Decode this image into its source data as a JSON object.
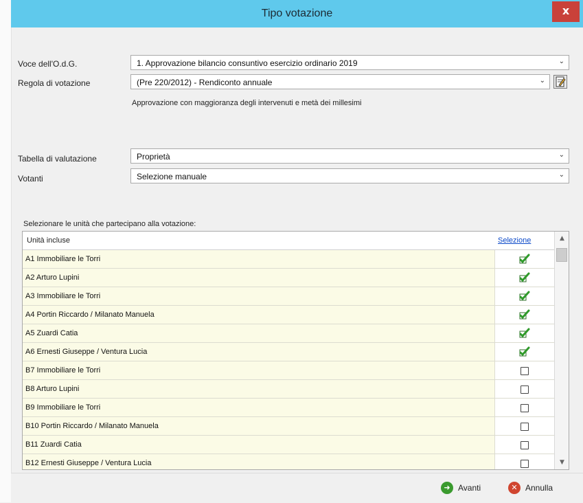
{
  "window": {
    "title": "Tipo votazione",
    "close_glyph": "x"
  },
  "form": {
    "voce_label": "Voce dell'O.d.G.",
    "voce_value": "1. Approvazione bilancio consuntivo esercizio ordinario 2019",
    "regola_label": "Regola di votazione",
    "regola_value": "(Pre 220/2012) - Rendiconto annuale",
    "regola_note": "Approvazione con maggioranza degli intervenuti e metà dei millesimi",
    "tabella_label": "Tabella di valutazione",
    "tabella_value": "Proprietà",
    "votanti_label": "Votanti",
    "votanti_value": "Selezione manuale"
  },
  "units": {
    "prompt": "Selezionare le unità che partecipano alla votazione:",
    "col_units": "Unità incluse",
    "col_selection": "Selezione",
    "rows": [
      {
        "name": "A1 Immobiliare le Torri",
        "selected": true
      },
      {
        "name": "A2 Arturo Lupini",
        "selected": true
      },
      {
        "name": "A3 Immobiliare le Torri",
        "selected": true
      },
      {
        "name": "A4 Portin Riccardo / Milanato Manuela",
        "selected": true
      },
      {
        "name": "A5 Zuardi Catia",
        "selected": true
      },
      {
        "name": "A6 Ernesti Giuseppe / Ventura Lucia",
        "selected": true
      },
      {
        "name": "B7 Immobiliare le Torri",
        "selected": false
      },
      {
        "name": "B8 Arturo Lupini",
        "selected": false
      },
      {
        "name": "B9 Immobiliare le Torri",
        "selected": false
      },
      {
        "name": "B10 Portin Riccardo / Milanato Manuela",
        "selected": false
      },
      {
        "name": "B11 Zuardi Catia",
        "selected": false
      },
      {
        "name": "B12 Ernesti Giuseppe / Ventura Lucia",
        "selected": false
      }
    ]
  },
  "footer": {
    "next_label": "Avanti",
    "cancel_label": "Annulla"
  },
  "colors": {
    "titlebar": "#5fc9ec",
    "close": "#c9413a",
    "row_bg": "#fbfbe6",
    "check": "#2f9a2a",
    "link": "#0a48c8"
  },
  "icons": {
    "next": "green-arrow-circle-icon",
    "cancel": "red-x-circle-icon",
    "edit": "edit-document-icon",
    "check": "green-check-icon"
  }
}
